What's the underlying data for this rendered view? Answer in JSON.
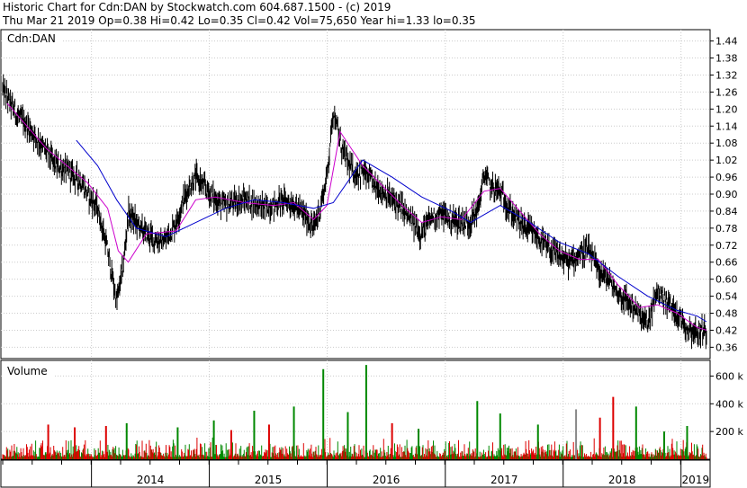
{
  "header": {
    "line1": "Historic Chart for Cdn:DAN by Stockwatch.com 604.687.1500 - (c) 2019",
    "line2": "Thu Mar 21 2019  Op=0.38  Hi=0.42  Lo=0.35  Cl=0.42  Vol=75,650  Year hi=1.33  lo=0.35"
  },
  "chart_data": [
    {
      "type": "line",
      "panel": "price",
      "title": "Cdn:DAN",
      "ylim": [
        0.32,
        1.48
      ],
      "y_ticks": [
        "1.44",
        "1.38",
        "1.32",
        "1.26",
        "1.20",
        "1.14",
        "1.08",
        "1.02",
        "0.96",
        "0.90",
        "0.84",
        "0.78",
        "0.72",
        "0.66",
        "0.60",
        "0.54",
        "0.48",
        "0.42",
        "0.36"
      ],
      "x_ticks": [
        "2014",
        "2015",
        "2016",
        "2017",
        "2018",
        "2019"
      ],
      "x_tick_dates": [
        "2014-01-01",
        "2015-01-01",
        "2016-01-01",
        "2017-01-01",
        "2018-01-01",
        "2019-01-01"
      ],
      "x_range": [
        "2013-04-01",
        "2019-03-21"
      ],
      "grid": true,
      "colors": {
        "price": "#000000",
        "ma_short": "#cc00cc",
        "ma_long": "#0000cc"
      },
      "series": [
        {
          "role": "price",
          "x": [
            "2013-04-01",
            "2013-05-15",
            "2013-07-01",
            "2013-08-15",
            "2013-09-15",
            "2013-10-20",
            "2013-11-25",
            "2013-12-20",
            "2014-01-20",
            "2014-02-20",
            "2014-03-20",
            "2014-04-10",
            "2014-04-25",
            "2014-05-20",
            "2014-06-10",
            "2014-07-15",
            "2014-08-15",
            "2014-09-20",
            "2014-10-20",
            "2014-11-20",
            "2014-12-20",
            "2015-01-20",
            "2015-02-20",
            "2015-03-20",
            "2015-04-20",
            "2015-05-20",
            "2015-06-20",
            "2015-07-20",
            "2015-08-20",
            "2015-09-20",
            "2015-10-20",
            "2015-11-20",
            "2015-12-10",
            "2015-12-31",
            "2016-01-20",
            "2016-02-10",
            "2016-03-05",
            "2016-03-25",
            "2016-04-20",
            "2016-05-20",
            "2016-06-20",
            "2016-07-20",
            "2016-08-20",
            "2016-09-20",
            "2016-10-20",
            "2016-11-20",
            "2016-12-20",
            "2017-01-20",
            "2017-02-20",
            "2017-03-20",
            "2017-04-15",
            "2017-05-01",
            "2017-05-20",
            "2017-06-20",
            "2017-07-20",
            "2017-08-20",
            "2017-09-20",
            "2017-10-20",
            "2017-11-20",
            "2017-12-20",
            "2018-01-20",
            "2018-02-20",
            "2018-03-20",
            "2018-04-20",
            "2018-05-20",
            "2018-06-20",
            "2018-07-20",
            "2018-08-10",
            "2018-08-25",
            "2018-09-20",
            "2018-10-20",
            "2018-11-20",
            "2018-12-20",
            "2019-01-20",
            "2019-02-20",
            "2019-03-21"
          ],
          "values": [
            1.27,
            1.18,
            1.12,
            1.05,
            1.0,
            0.98,
            0.95,
            0.9,
            0.85,
            0.7,
            0.52,
            0.65,
            0.83,
            0.8,
            0.77,
            0.74,
            0.73,
            0.8,
            0.9,
            0.96,
            0.92,
            0.88,
            0.86,
            0.87,
            0.88,
            0.87,
            0.85,
            0.86,
            0.88,
            0.86,
            0.83,
            0.78,
            0.85,
            0.96,
            1.2,
            1.08,
            1.01,
            0.97,
            0.98,
            0.94,
            0.91,
            0.88,
            0.85,
            0.8,
            0.76,
            0.82,
            0.83,
            0.81,
            0.8,
            0.8,
            0.86,
            0.97,
            0.93,
            0.91,
            0.84,
            0.8,
            0.77,
            0.74,
            0.7,
            0.68,
            0.66,
            0.69,
            0.7,
            0.63,
            0.6,
            0.55,
            0.52,
            0.5,
            0.47,
            0.44,
            0.56,
            0.52,
            0.48,
            0.43,
            0.41,
            0.42
          ]
        },
        {
          "role": "ma_short",
          "x": [
            "2013-04-15",
            "2013-08-15",
            "2013-12-20",
            "2014-02-20",
            "2014-03-25",
            "2014-04-25",
            "2014-06-20",
            "2014-09-20",
            "2014-11-20",
            "2015-01-20",
            "2015-04-20",
            "2015-07-20",
            "2015-09-20",
            "2015-11-20",
            "2015-12-31",
            "2016-02-10",
            "2016-04-20",
            "2016-06-20",
            "2016-08-20",
            "2016-10-20",
            "2016-12-20",
            "2017-02-20",
            "2017-05-01",
            "2017-06-20",
            "2017-08-20",
            "2017-10-20",
            "2017-12-20",
            "2018-02-20",
            "2018-04-20",
            "2018-06-20",
            "2018-08-25",
            "2018-10-20",
            "2018-12-20",
            "2019-02-20",
            "2019-03-21"
          ],
          "values": [
            1.22,
            1.06,
            0.94,
            0.85,
            0.7,
            0.66,
            0.76,
            0.77,
            0.88,
            0.89,
            0.87,
            0.86,
            0.87,
            0.81,
            0.86,
            1.12,
            1.0,
            0.93,
            0.86,
            0.8,
            0.82,
            0.81,
            0.91,
            0.92,
            0.84,
            0.76,
            0.7,
            0.67,
            0.67,
            0.58,
            0.5,
            0.51,
            0.48,
            0.43,
            0.42
          ]
        },
        {
          "role": "ma_long",
          "x": [
            "2013-11-15",
            "2014-01-20",
            "2014-03-20",
            "2014-05-20",
            "2014-08-20",
            "2014-11-20",
            "2015-02-20",
            "2015-05-20",
            "2015-08-20",
            "2015-11-20",
            "2016-01-20",
            "2016-04-20",
            "2016-07-20",
            "2016-10-20",
            "2017-01-20",
            "2017-03-20",
            "2017-06-20",
            "2017-09-20",
            "2017-12-20",
            "2018-03-20",
            "2018-06-20",
            "2018-09-20",
            "2018-12-20",
            "2019-02-20",
            "2019-03-21"
          ],
          "values": [
            1.09,
            1.0,
            0.88,
            0.78,
            0.75,
            0.8,
            0.85,
            0.88,
            0.87,
            0.85,
            0.87,
            1.02,
            0.96,
            0.89,
            0.84,
            0.8,
            0.86,
            0.8,
            0.73,
            0.69,
            0.61,
            0.54,
            0.49,
            0.47,
            0.45
          ]
        }
      ]
    },
    {
      "type": "bar",
      "panel": "volume",
      "title": "Volume",
      "ylim": [
        0,
        700000
      ],
      "y_ticks": [
        200000,
        400000,
        600000
      ],
      "y_tick_labels": [
        "200 k",
        "400 k",
        "600 k"
      ],
      "colors": {
        "up": "#008800",
        "down": "#dd0000",
        "neutral": "#888888"
      },
      "spikes": [
        {
          "date": "2013-08-20",
          "value": 250000,
          "dir": "down"
        },
        {
          "date": "2013-11-10",
          "value": 230000,
          "dir": "down"
        },
        {
          "date": "2014-02-15",
          "value": 240000,
          "dir": "down"
        },
        {
          "date": "2014-04-20",
          "value": 260000,
          "dir": "up"
        },
        {
          "date": "2014-09-25",
          "value": 230000,
          "dir": "up"
        },
        {
          "date": "2015-01-15",
          "value": 280000,
          "dir": "up"
        },
        {
          "date": "2015-03-10",
          "value": 210000,
          "dir": "down"
        },
        {
          "date": "2015-05-20",
          "value": 350000,
          "dir": "up"
        },
        {
          "date": "2015-07-05",
          "value": 250000,
          "dir": "down"
        },
        {
          "date": "2015-09-20",
          "value": 380000,
          "dir": "up"
        },
        {
          "date": "2015-12-20",
          "value": 650000,
          "dir": "up"
        },
        {
          "date": "2016-03-05",
          "value": 340000,
          "dir": "up"
        },
        {
          "date": "2016-05-01",
          "value": 680000,
          "dir": "up"
        },
        {
          "date": "2016-07-20",
          "value": 260000,
          "dir": "down"
        },
        {
          "date": "2016-10-10",
          "value": 220000,
          "dir": "up"
        },
        {
          "date": "2017-04-10",
          "value": 420000,
          "dir": "up"
        },
        {
          "date": "2017-06-20",
          "value": 330000,
          "dir": "up"
        },
        {
          "date": "2017-10-15",
          "value": 250000,
          "dir": "up"
        },
        {
          "date": "2018-02-10",
          "value": 360000,
          "dir": "neutral"
        },
        {
          "date": "2018-04-25",
          "value": 300000,
          "dir": "down"
        },
        {
          "date": "2018-06-05",
          "value": 450000,
          "dir": "down"
        },
        {
          "date": "2018-08-15",
          "value": 380000,
          "dir": "up"
        },
        {
          "date": "2018-11-10",
          "value": 200000,
          "dir": "up"
        },
        {
          "date": "2019-01-20",
          "value": 240000,
          "dir": "up"
        }
      ]
    }
  ]
}
